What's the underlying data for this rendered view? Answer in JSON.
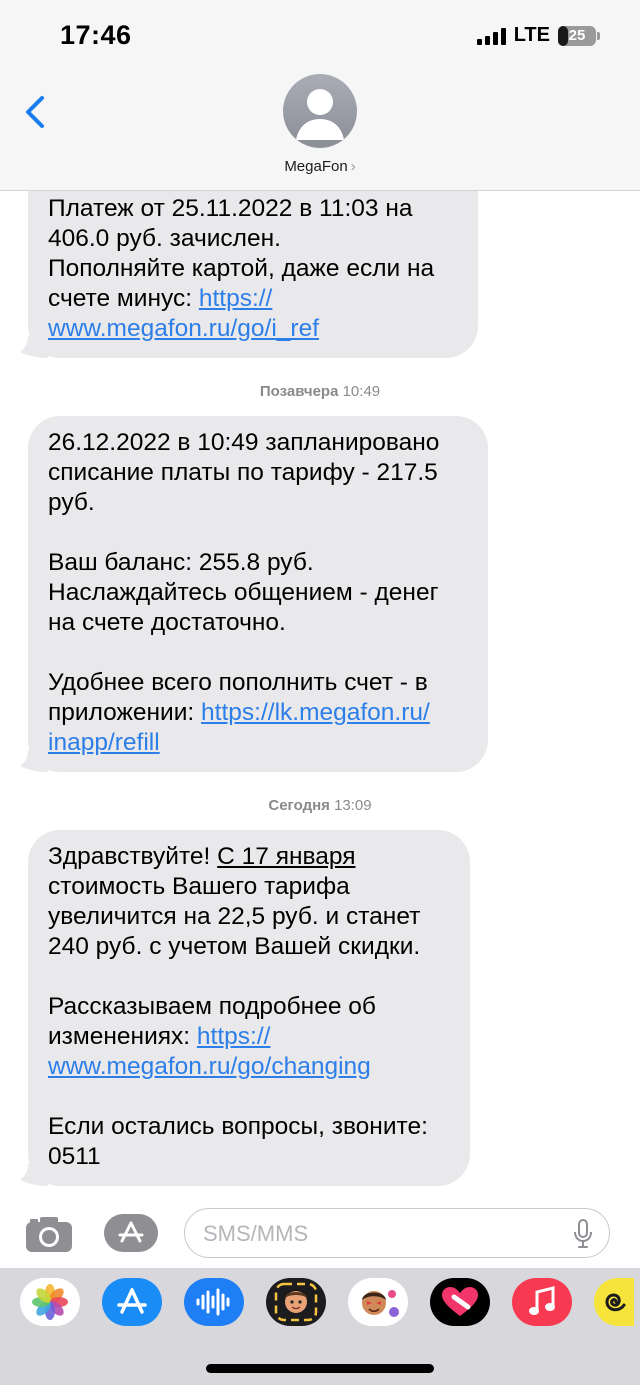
{
  "status_bar": {
    "time": "17:46",
    "network": "LTE",
    "battery": "25"
  },
  "header": {
    "back_icon": "chevron-left-icon",
    "contact_name": "MegaFon",
    "chevron": "›"
  },
  "messages": [
    {
      "lines": [
        "Платеж от 25.11.2022 в 11:03 на",
        "406.0 руб. зачислен.",
        "Пополняйте картой, даже если на",
        "счете минус: "
      ],
      "link1": "https://",
      "link2": "www.megafon.ru/go/i_ref"
    },
    {
      "timestamp_day": "Позавчера",
      "timestamp_time": "10:49",
      "lines": [
        "26.12.2022 в 10:49 запланировано",
        "списание платы по тарифу - 217.5",
        "руб.",
        "Ваш баланс: 255.8 руб.",
        "Наслаждайтесь общением - денег",
        "на счете достаточно.",
        "Удобнее всего пополнить счет - в",
        "приложении: "
      ],
      "link1": "https://lk.megafon.ru/",
      "link2": "inapp/refill"
    },
    {
      "timestamp_day": "Сегодня",
      "timestamp_time": "13:09",
      "greeting": "Здравствуйте! ",
      "date_text": "С 17 января",
      "lines": [
        "стоимость Вашего тарифа",
        "увеличится на 22,5 руб. и станет",
        "240 руб. с учетом Вашей скидки.",
        "Рассказываем подробнее об",
        "изменениях: ",
        "Если остались вопросы, звоните:",
        "0511"
      ],
      "link1": "https://",
      "link2": "www.megafon.ru/go/changing"
    }
  ],
  "compose": {
    "placeholder": "SMS/MMS",
    "camera_icon": "camera-icon",
    "apps_icon": "app-store-icon",
    "mic_icon": "microphone-icon"
  },
  "drawer": {
    "apps": [
      {
        "name": "photos-app-icon",
        "bg": "#ffffff"
      },
      {
        "name": "app-store-app-icon",
        "bg": "#1a8cf5"
      },
      {
        "name": "audio-message-app-icon",
        "bg": "#1e7ef5"
      },
      {
        "name": "memoji-app-icon",
        "bg": "#1c1c1e"
      },
      {
        "name": "memoji-stickers-app-icon",
        "bg": "#ffffff"
      },
      {
        "name": "digital-touch-app-icon",
        "bg": "#000000"
      },
      {
        "name": "music-app-icon",
        "bg": "#f73a52"
      },
      {
        "name": "spiral-app-icon",
        "bg": "#f6e43a"
      }
    ]
  },
  "colors": {
    "bubble": "#e9e9eb",
    "link": "#2c7ee8",
    "accent": "#1a7cf0",
    "header_bg": "#f6f6f6"
  }
}
